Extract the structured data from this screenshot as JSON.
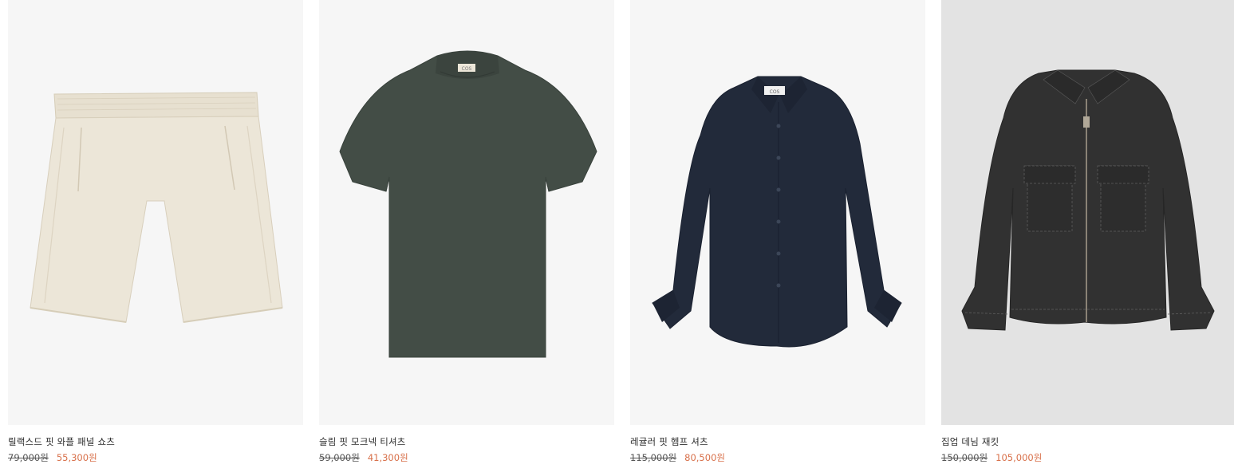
{
  "products": [
    {
      "name": "릴랙스드 핏 와플 패널 쇼츠",
      "original_price": "79,000원",
      "sale_price": "55,300원",
      "image_icon": "shorts-image",
      "color": "#ece6d8"
    },
    {
      "name": "슬림 핏 모크넥 티셔츠",
      "original_price": "59,000원",
      "sale_price": "41,300원",
      "image_icon": "tshirt-image",
      "color": "#434d46"
    },
    {
      "name": "레귤러 핏 헴프 셔츠",
      "original_price": "115,000원",
      "sale_price": "80,500원",
      "image_icon": "shirt-image",
      "color": "#222a3a"
    },
    {
      "name": "집업 데님 재킷",
      "original_price": "150,000원",
      "sale_price": "105,000원",
      "image_icon": "jacket-image",
      "color": "#313131"
    }
  ],
  "labels": {
    "brand_tag": "COS"
  },
  "colors": {
    "sale_price": "#d8704a",
    "image_background": "#f6f6f6",
    "image_background_alt": "#e3e3e3"
  }
}
